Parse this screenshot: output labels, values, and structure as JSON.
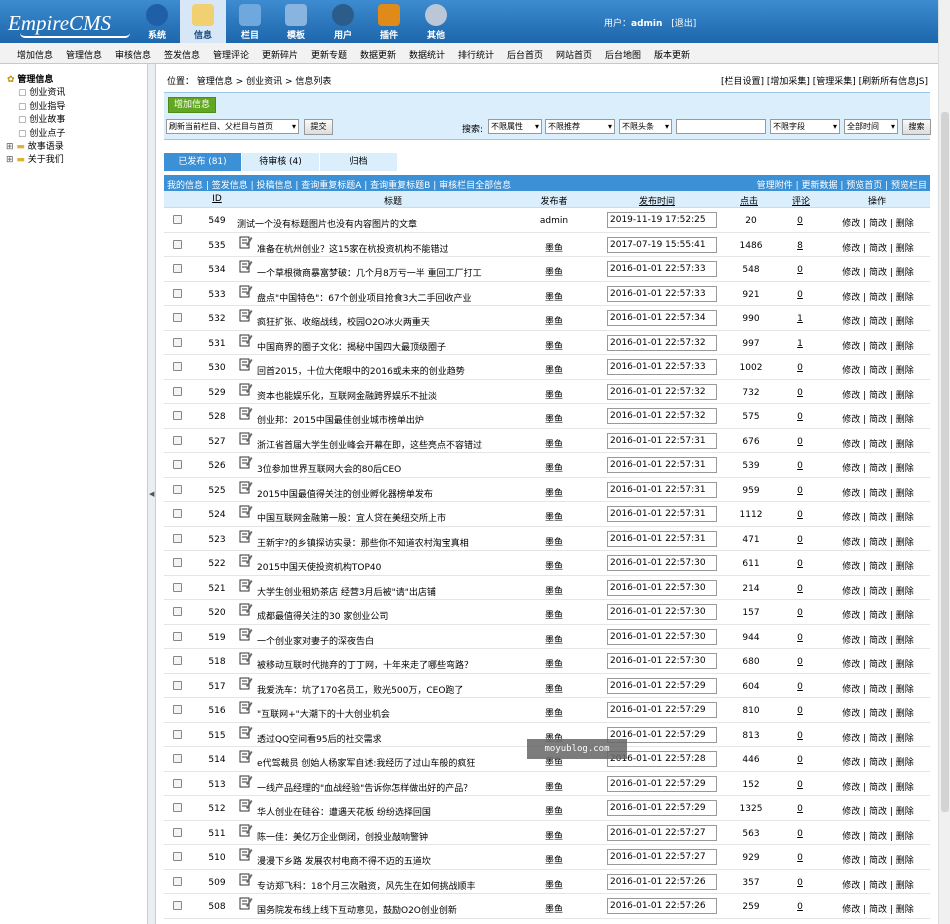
{
  "app": {
    "logo_text": "EmpireCMS",
    "nav": [
      {
        "label": "系统",
        "icon": "globe-icon",
        "active": false
      },
      {
        "label": "信息",
        "icon": "notepad-icon",
        "active": true
      },
      {
        "label": "栏目",
        "icon": "folder-icon",
        "active": false
      },
      {
        "label": "模板",
        "icon": "monitor-icon",
        "active": false
      },
      {
        "label": "用户",
        "icon": "user-icon",
        "active": false
      },
      {
        "label": "插件",
        "icon": "tools-icon",
        "active": false
      },
      {
        "label": "其他",
        "icon": "gear-icon",
        "active": false
      }
    ],
    "user_prefix": "用户：",
    "user_name": "admin",
    "logout_label": "[退出]"
  },
  "menubar": [
    "增加信息",
    "管理信息",
    "审核信息",
    "签发信息",
    "管理评论",
    "更新碎片",
    "更新专题",
    "数据更新",
    "数据统计",
    "排行统计",
    "后台首页",
    "网站首页",
    "后台地图",
    "版本更新"
  ],
  "sidebar": {
    "root": "管理信息",
    "items": [
      "创业资讯",
      "创业指导",
      "创业故事",
      "创业点子"
    ],
    "folders": [
      "故事语录",
      "关于我们"
    ]
  },
  "breadcrumb": {
    "prefix": "位置：",
    "path": "管理信息 > 创业资讯 > 信息列表",
    "right_links": "[栏目设置] [增加采集] [管理采集] [刷新所有信息JS]"
  },
  "toolbar": {
    "add_button": "增加信息",
    "refresh_select": "刷新当前栏目、父栏目与首页",
    "submit_button": "提交",
    "search_label": "搜索:",
    "filter_attr": "不限属性",
    "filter_recommend": "不限推荐",
    "filter_headline": "不限头条",
    "search_value": "",
    "filter_field": "不限字段",
    "filter_time": "全部时间",
    "search_button": "搜索"
  },
  "tabs": [
    {
      "label": "已发布 (81)",
      "active": true
    },
    {
      "label": "待审核 (4)",
      "active": false
    },
    {
      "label": "归档",
      "active": false
    }
  ],
  "linkbar": {
    "left": "我的信息 | 签发信息 | 投稿信息 | 查询重复标题A | 查询重复标题B | 审核栏目全部信息",
    "right": "管理附件 | 更新数据 | 预览首页 | 预览栏目"
  },
  "table": {
    "headers": [
      "ID",
      "标题",
      "发布者",
      "发布时间",
      "点击",
      "评论",
      "操作"
    ],
    "ops": "修改 | 简改 | 删除",
    "rows": [
      {
        "id": "549",
        "title": "测试一个没有标题图片也没有内容图片的文章",
        "publisher": "admin",
        "time": "2019-11-19 17:52:25",
        "clicks": "20",
        "comments": "0",
        "has_icon": false
      },
      {
        "id": "535",
        "title": "准备在杭州创业？这15家在杭投资机构不能错过",
        "publisher": "墨鱼",
        "time": "2017-07-19 15:55:41",
        "clicks": "1486",
        "comments": "8",
        "has_icon": true
      },
      {
        "id": "534",
        "title": "一个草根微商暴富梦破：几个月8万亏一半 重回工厂打工",
        "publisher": "墨鱼",
        "time": "2016-01-01 22:57:33",
        "clicks": "548",
        "comments": "0",
        "has_icon": true
      },
      {
        "id": "533",
        "title": "盘点\"中国特色\"：67个创业项目抢食3大二手回收产业",
        "publisher": "墨鱼",
        "time": "2016-01-01 22:57:33",
        "clicks": "921",
        "comments": "0",
        "has_icon": true
      },
      {
        "id": "532",
        "title": "疯狂扩张、收缩战线，校园O2O冰火两重天",
        "publisher": "墨鱼",
        "time": "2016-01-01 22:57:34",
        "clicks": "990",
        "comments": "1",
        "has_icon": true
      },
      {
        "id": "531",
        "title": "中国商界的圈子文化：揭秘中国四大最顶级圈子",
        "publisher": "墨鱼",
        "time": "2016-01-01 22:57:32",
        "clicks": "997",
        "comments": "1",
        "has_icon": true
      },
      {
        "id": "530",
        "title": "回首2015，十位大佬眼中的2016或未来的创业趋势",
        "publisher": "墨鱼",
        "time": "2016-01-01 22:57:33",
        "clicks": "1002",
        "comments": "0",
        "has_icon": true
      },
      {
        "id": "529",
        "title": "资本也能娱乐化，互联网金融跨界娱乐不扯淡",
        "publisher": "墨鱼",
        "time": "2016-01-01 22:57:32",
        "clicks": "732",
        "comments": "0",
        "has_icon": true
      },
      {
        "id": "528",
        "title": "创业邦：2015中国最佳创业城市榜单出炉",
        "publisher": "墨鱼",
        "time": "2016-01-01 22:57:32",
        "clicks": "575",
        "comments": "0",
        "has_icon": true
      },
      {
        "id": "527",
        "title": "浙江省首届大学生创业峰会开幕在即，这些亮点不容错过",
        "publisher": "墨鱼",
        "time": "2016-01-01 22:57:31",
        "clicks": "676",
        "comments": "0",
        "has_icon": true
      },
      {
        "id": "526",
        "title": "3位参加世界互联网大会的80后CEO",
        "publisher": "墨鱼",
        "time": "2016-01-01 22:57:31",
        "clicks": "539",
        "comments": "0",
        "has_icon": true
      },
      {
        "id": "525",
        "title": "2015中国最值得关注的创业孵化器榜单发布",
        "publisher": "墨鱼",
        "time": "2016-01-01 22:57:31",
        "clicks": "959",
        "comments": "0",
        "has_icon": true
      },
      {
        "id": "524",
        "title": "中国互联网金融第一股：宜人贷在美纽交所上市",
        "publisher": "墨鱼",
        "time": "2016-01-01 22:57:31",
        "clicks": "1112",
        "comments": "0",
        "has_icon": true
      },
      {
        "id": "523",
        "title": "王新宇?的乡镇探访实录：那些你不知道农村淘宝真相",
        "publisher": "墨鱼",
        "time": "2016-01-01 22:57:31",
        "clicks": "471",
        "comments": "0",
        "has_icon": true
      },
      {
        "id": "522",
        "title": "2015中国天使投资机构TOP40",
        "publisher": "墨鱼",
        "time": "2016-01-01 22:57:30",
        "clicks": "611",
        "comments": "0",
        "has_icon": true
      },
      {
        "id": "521",
        "title": "大学生创业租奶茶店 经营3月后被\"请\"出店铺",
        "publisher": "墨鱼",
        "time": "2016-01-01 22:57:30",
        "clicks": "214",
        "comments": "0",
        "has_icon": true
      },
      {
        "id": "520",
        "title": "成都最值得关注的30 家创业公司",
        "publisher": "墨鱼",
        "time": "2016-01-01 22:57:30",
        "clicks": "157",
        "comments": "0",
        "has_icon": true
      },
      {
        "id": "519",
        "title": "一个创业家对妻子的深夜告白",
        "publisher": "墨鱼",
        "time": "2016-01-01 22:57:30",
        "clicks": "944",
        "comments": "0",
        "has_icon": true
      },
      {
        "id": "518",
        "title": "被移动互联时代抛弃的丁丁网，十年来走了哪些弯路？",
        "publisher": "墨鱼",
        "time": "2016-01-01 22:57:30",
        "clicks": "680",
        "comments": "0",
        "has_icon": true
      },
      {
        "id": "517",
        "title": "我爱洗车：坑了170名员工，败光500万，CEO跑了",
        "publisher": "墨鱼",
        "time": "2016-01-01 22:57:29",
        "clicks": "604",
        "comments": "0",
        "has_icon": true
      },
      {
        "id": "516",
        "title": "\"互联网+\"大潮下的十大创业机会",
        "publisher": "墨鱼",
        "time": "2016-01-01 22:57:29",
        "clicks": "810",
        "comments": "0",
        "has_icon": true
      },
      {
        "id": "515",
        "title": "透过QQ空间看95后的社交需求",
        "publisher": "墨鱼",
        "time": "2016-01-01 22:57:29",
        "clicks": "813",
        "comments": "0",
        "has_icon": true
      },
      {
        "id": "514",
        "title": "e代驾裁员 创始人杨家军自述:我经历了过山车般的疯狂",
        "publisher": "墨鱼",
        "time": "2016-01-01 22:57:28",
        "clicks": "446",
        "comments": "0",
        "has_icon": true
      },
      {
        "id": "513",
        "title": "一线产品经理的\"血战经验\"告诉你怎样做出好的产品？",
        "publisher": "墨鱼",
        "time": "2016-01-01 22:57:29",
        "clicks": "152",
        "comments": "0",
        "has_icon": true
      },
      {
        "id": "512",
        "title": "华人创业在硅谷：遭遇天花板 纷纷选择回国",
        "publisher": "墨鱼",
        "time": "2016-01-01 22:57:29",
        "clicks": "1325",
        "comments": "0",
        "has_icon": true
      },
      {
        "id": "511",
        "title": "陈一佳：美亿万企业倒闭，创投业敲响警钟",
        "publisher": "墨鱼",
        "time": "2016-01-01 22:57:27",
        "clicks": "563",
        "comments": "0",
        "has_icon": true
      },
      {
        "id": "510",
        "title": "漫漫下乡路 发展农村电商不得不迈的五道坎",
        "publisher": "墨鱼",
        "time": "2016-01-01 22:57:27",
        "clicks": "929",
        "comments": "0",
        "has_icon": true
      },
      {
        "id": "509",
        "title": "专访郑飞科：18个月三次融资，风先生在如何挑战顺丰",
        "publisher": "墨鱼",
        "time": "2016-01-01 22:57:26",
        "clicks": "357",
        "comments": "0",
        "has_icon": true
      },
      {
        "id": "508",
        "title": "国务院发布线上线下互动意见，鼓励O2O创业创新",
        "publisher": "墨鱼",
        "time": "2016-01-01 22:57:26",
        "clicks": "259",
        "comments": "0",
        "has_icon": true
      }
    ]
  },
  "watermark": "moyublog.com",
  "colors": {
    "topbar": "#2a77bd",
    "accent": "#3c90d6",
    "add_button": "#62a721",
    "row_header": "#dbeefb"
  }
}
